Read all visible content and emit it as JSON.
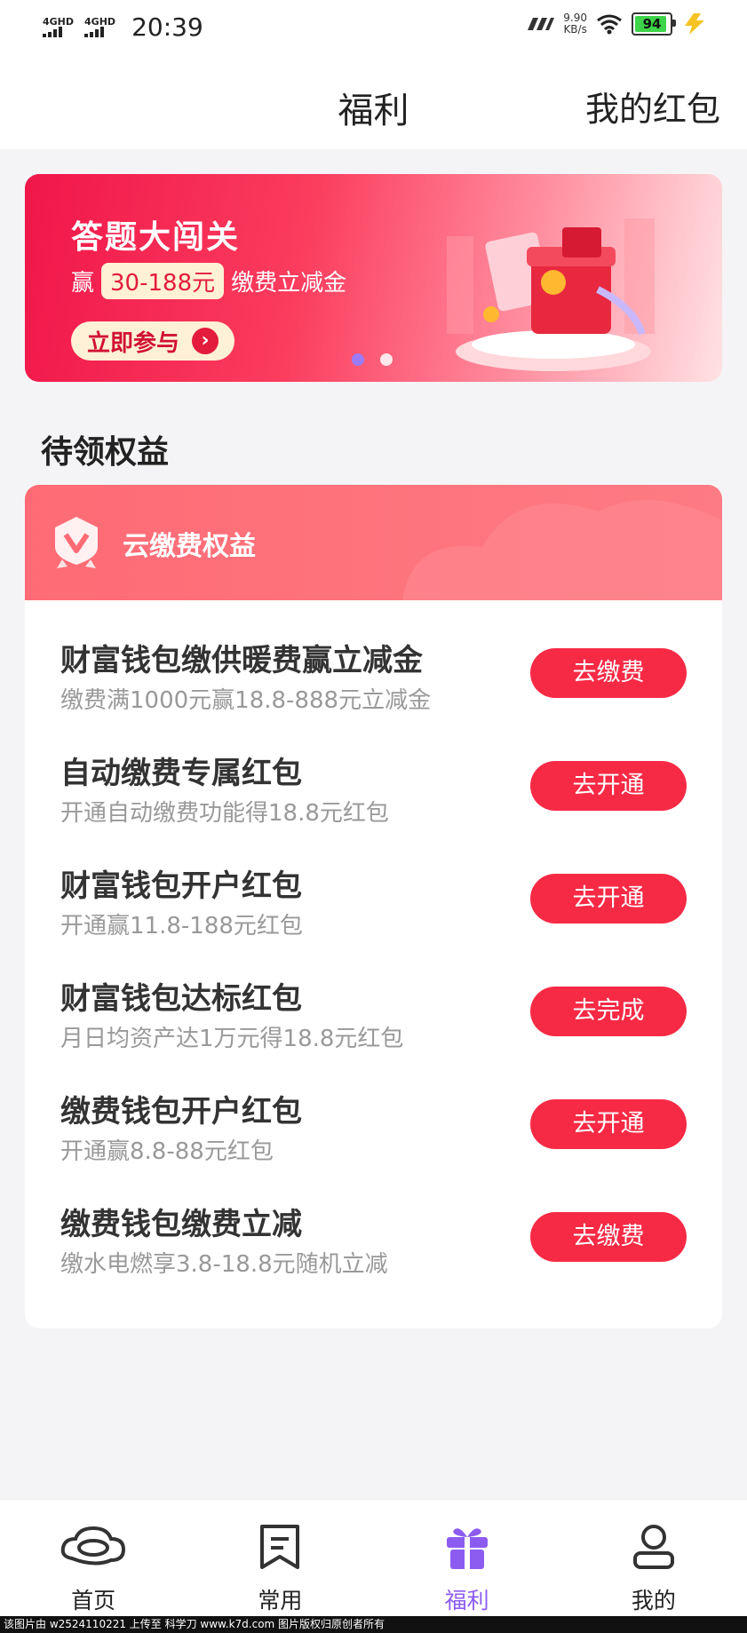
{
  "status_bar": {
    "signal1": "4GHD",
    "signal2": "4GHD",
    "time": "20:39",
    "speed_value": "9.90",
    "speed_unit": "KB/s",
    "battery": "94"
  },
  "header": {
    "title": "福利",
    "right_link": "我的红包"
  },
  "banner": {
    "title": "答题大闯关",
    "prefix": "赢",
    "amount": "30-188元",
    "suffix": "缴费立减金",
    "button": "立即参与",
    "active_slide": 1,
    "slide_count": 2
  },
  "section_title": "待领权益",
  "benefits_card": {
    "title": "云缴费权益",
    "items": [
      {
        "title": "财富钱包缴供暖费赢立减金",
        "subtitle": "缴费满1000元赢18.8-888元立减金",
        "action": "去缴费"
      },
      {
        "title": "自动缴费专属红包",
        "subtitle": "开通自动缴费功能得18.8元红包",
        "action": "去开通"
      },
      {
        "title": "财富钱包开户红包",
        "subtitle": "开通赢11.8-188元红包",
        "action": "去开通"
      },
      {
        "title": "财富钱包达标红包",
        "subtitle": "月日均资产达1万元得18.8元红包",
        "action": "去完成"
      },
      {
        "title": "缴费钱包开户红包",
        "subtitle": "开通赢8.8-88元红包",
        "action": "去开通"
      },
      {
        "title": "缴费钱包缴费立减",
        "subtitle": "缴水电燃享3.8-18.8元随机立减",
        "action": "去缴费"
      }
    ]
  },
  "tabbar": {
    "tabs": [
      {
        "label": "首页",
        "icon": "home-cloud-icon"
      },
      {
        "label": "常用",
        "icon": "bookmark-note-icon"
      },
      {
        "label": "福利",
        "icon": "gift-icon"
      },
      {
        "label": "我的",
        "icon": "user-icon"
      }
    ],
    "active_color": "#8c5cf0"
  },
  "watermark": "该图片由 w2524110221 上传至 科学刀 www.k7d.com 图片版权归原创者所有",
  "colors": {
    "accent_red": "#f72a45",
    "card_header": "#fe6b75"
  }
}
